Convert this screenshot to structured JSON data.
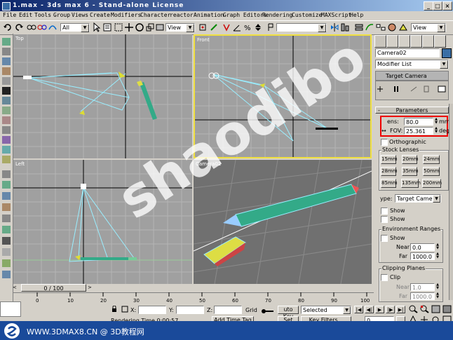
{
  "window": {
    "title": "1.max - 3ds max 6 - Stand-alone License"
  },
  "menu": [
    "File",
    "Edit",
    "Tools",
    "Group",
    "Views",
    "Create",
    "Modifiers",
    "Character",
    "reactor",
    "Animation",
    "Graph Editors",
    "Rendering",
    "Customize",
    "MAXScript",
    "Help"
  ],
  "toolbar": {
    "selection_filter": "All",
    "ref_coord": "View",
    "named_sel": "",
    "view_dd": "View"
  },
  "viewports": {
    "top": "Top",
    "front": "Front",
    "left": "Left",
    "camera": "Camera02"
  },
  "panel": {
    "object_name": "Camera02",
    "modifier_list": "Modifier List",
    "stack_item": "Target Camera",
    "rollout_title": "Parameters",
    "lens_label": "ens:",
    "lens_value": "80.0",
    "lens_unit": "mm",
    "fov_label": "FOV:",
    "fov_value": "25.361",
    "fov_unit": "deg.",
    "orthographic": "Orthographic",
    "stock_lenses": "Stock Lenses",
    "lenses": [
      "15mm",
      "20mm",
      "24mm",
      "28mm",
      "35mm",
      "50mm",
      "85mm",
      "135mm",
      "200mm"
    ],
    "type_label": "ype:",
    "type_value": "Target Camer",
    "show1": "Show",
    "show2": "Show",
    "env_ranges": "Environment Ranges",
    "env_show": "Show",
    "near_label": "Near",
    "near_value": "0.0",
    "far_label": "Far",
    "far_value": "1000.0",
    "clipping": "Clipping Planes",
    "clip": "Clip",
    "clip_near_label": "Near",
    "clip_near_value": "1.0",
    "clip_far_label": "Far",
    "clip_far_value": "1000.0"
  },
  "timeline": {
    "frame": "0 / 100",
    "ticks": [
      "0",
      "10",
      "20",
      "30",
      "40",
      "50",
      "60",
      "70",
      "80",
      "90",
      "100"
    ]
  },
  "status": {
    "x_label": "X:",
    "y_label": "Y:",
    "z_label": "Z:",
    "grid": "Grid",
    "autokey": "uto Key",
    "selected": "Selected",
    "setkey": "Set Key",
    "keyfilters": "Key Filters...",
    "rendering_time": "Rendering Time  0:00:57",
    "add_time_tag": "Add Time Tag",
    "frame_field": "0"
  },
  "overlay": {
    "watermark_text": "shaodibo",
    "site": "WWW.3DMAX8.CN @ 3D教程网"
  }
}
